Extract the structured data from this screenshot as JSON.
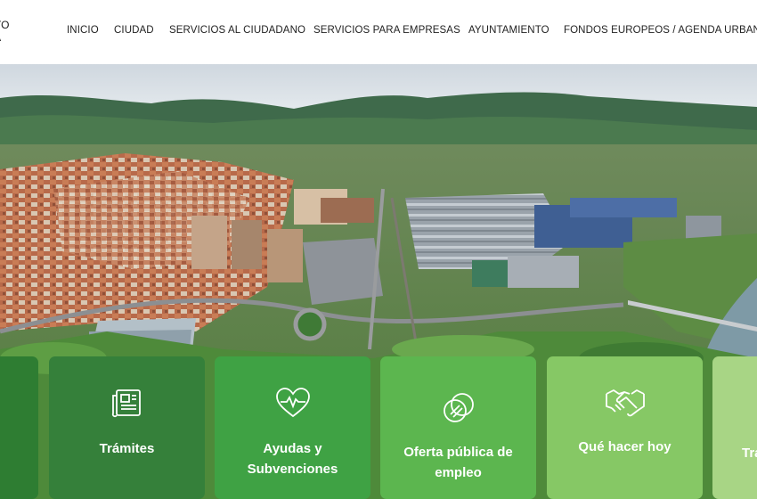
{
  "header": {
    "logo_line1": "TO",
    "logo_line2": "A",
    "nav": [
      "INICIO",
      "CIUDAD",
      "SERVICIOS AL CIUDADANO",
      "SERVICIOS PARA EMPRESAS",
      "AYUNTAMIENTO",
      "FONDOS EUROPEOS / AGENDA URBANA"
    ]
  },
  "hero": {
    "image": "aerial-city-view"
  },
  "tiles": [
    {
      "label": "",
      "icon": "",
      "color": "#2e7d32"
    },
    {
      "label": "Trámites",
      "icon": "newspaper-icon",
      "color": "#35803a"
    },
    {
      "label": "Ayudas y Subvenciones",
      "icon": "heart-pulse-icon",
      "color": "#3fa244"
    },
    {
      "label": "Oferta pública de empleo",
      "icon": "coins-icon",
      "color": "#5cb64f"
    },
    {
      "label": "Qué hacer hoy",
      "icon": "handshake-icon",
      "color": "#86c865"
    },
    {
      "label": "Tra",
      "icon": "",
      "color": "#a8d585"
    }
  ],
  "colors": {
    "nav_text": "#222222",
    "tile_text": "#ffffff"
  }
}
